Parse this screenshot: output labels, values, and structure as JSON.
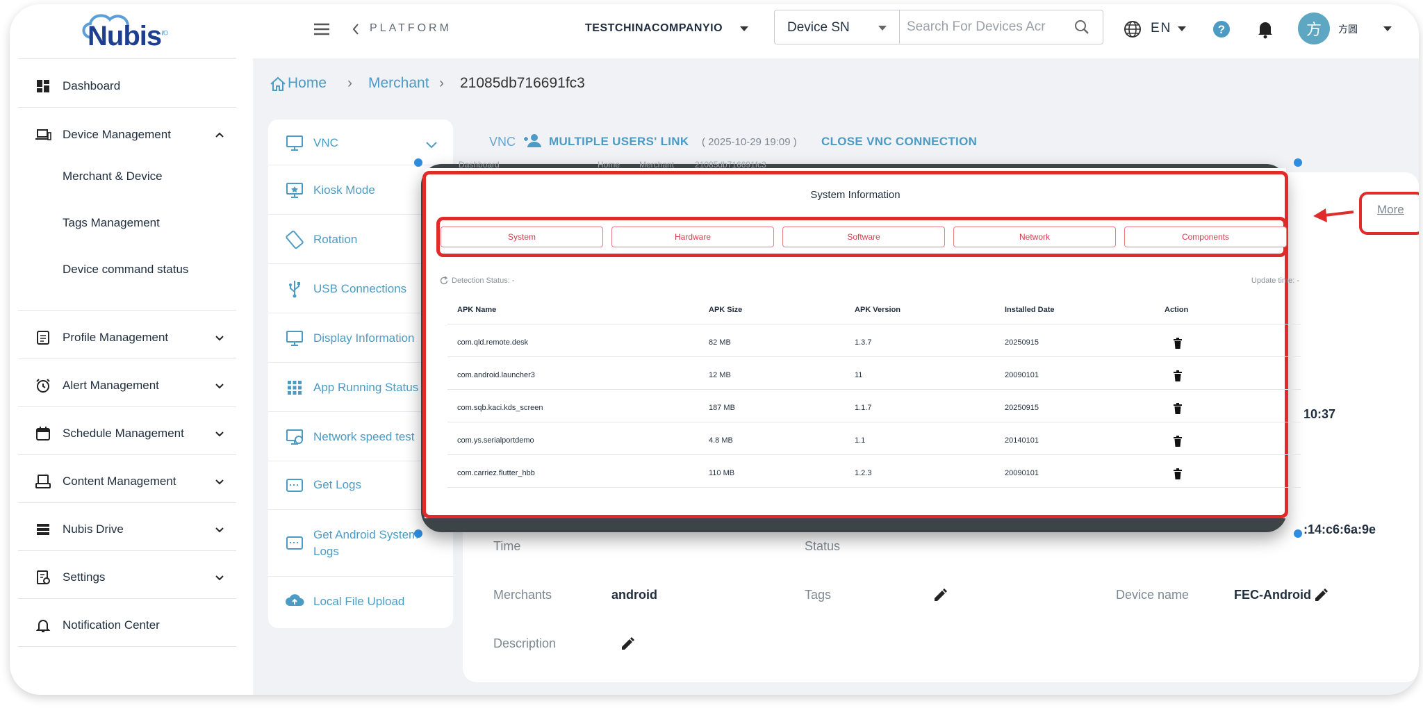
{
  "app": {
    "logo_text": "Nubis",
    "logo_superscript": "I/O"
  },
  "header": {
    "platform": "PLATFORM",
    "company": "TESTCHINACOMPANYIO",
    "search_type": "Device SN",
    "search_placeholder": "Search For Devices Acr",
    "language": "EN",
    "avatar_initial": "方",
    "username": "方圆"
  },
  "sidebar": {
    "items": [
      {
        "label": "Dashboard",
        "icon": "dashboard-icon"
      },
      {
        "label": "Device Management",
        "icon": "devices-icon",
        "expanded": true,
        "children": [
          "Merchant & Device",
          "Tags Management",
          "Device command status"
        ]
      },
      {
        "label": "Profile Management",
        "icon": "profile-icon"
      },
      {
        "label": "Alert Management",
        "icon": "alarm-icon"
      },
      {
        "label": "Schedule Management",
        "icon": "calendar-icon"
      },
      {
        "label": "Content Management",
        "icon": "content-icon"
      },
      {
        "label": "Nubis Drive",
        "icon": "drive-icon"
      },
      {
        "label": "Settings",
        "icon": "settings-icon"
      },
      {
        "label": "Notification Center",
        "icon": "bell-icon"
      }
    ]
  },
  "breadcrumb": {
    "home": "Home",
    "merchant": "Merchant",
    "device": "21085db716691fc3"
  },
  "device_menu": {
    "items": [
      {
        "label": "VNC",
        "icon": "vnc-icon"
      },
      {
        "label": "Kiosk Mode",
        "icon": "kiosk-icon"
      },
      {
        "label": "Rotation",
        "icon": "rotation-icon"
      },
      {
        "label": "USB Connections",
        "icon": "usb-icon"
      },
      {
        "label": "Display Information",
        "icon": "monitor-icon"
      },
      {
        "label": "App Running Status",
        "icon": "apps-grid-icon"
      },
      {
        "label": "Network speed test",
        "icon": "speed-test-icon"
      },
      {
        "label": "Get Logs",
        "icon": "logs-icon"
      },
      {
        "label": "Get Android System Logs",
        "icon": "android-logs-icon"
      },
      {
        "label": "Local File Upload",
        "icon": "cloud-upload-icon"
      }
    ]
  },
  "vnc_bar": {
    "label": "VNC",
    "multi_link": "MULTIPLE USERS' LINK",
    "timestamp": "( 2025-10-29 19:09 )",
    "close": "CLOSE VNC CONNECTION"
  },
  "vnc_ghost": {
    "dashboard": "Dashboard",
    "home": "Home",
    "merchant": "Merchant",
    "device": "21085db716691fc3"
  },
  "system_info": {
    "title": "System Information",
    "tabs": [
      "System",
      "Hardware",
      "Software",
      "Network",
      "Components"
    ],
    "detection_status": "Detection Status: -",
    "update_time": "Update time: -",
    "columns": [
      "APK Name",
      "APK Size",
      "APK Version",
      "Installed Date",
      "Action"
    ],
    "rows": [
      [
        "com.qld.remote.desk",
        "82 MB",
        "1.3.7",
        "20250915"
      ],
      [
        "com.android.launcher3",
        "12 MB",
        "11",
        "20090101"
      ],
      [
        "com.sqb.kaci.kds_screen",
        "187 MB",
        "1.1.7",
        "20250915"
      ],
      [
        "com.ys.serialportdemo",
        "4.8 MB",
        "1.1",
        "20140101"
      ],
      [
        "com.carriez.flutter_hbb",
        "110 MB",
        "1.2.3",
        "20090101"
      ]
    ]
  },
  "details": {
    "more": "More",
    "time_partial": "10:37",
    "label_time_1": "Time",
    "label_status": "Status",
    "mac_partial": ":14:c6:6a:9e",
    "merchants_label": "Merchants",
    "merchants_value": "android",
    "tags_label": "Tags",
    "device_name_label": "Device name",
    "device_name_value": "FEC-Android",
    "description_label": "Description"
  },
  "colors": {
    "accent": "#4c9bc4",
    "brand": "#1e3f8f",
    "highlight": "#e02b2b",
    "tab_text": "#d23c4e"
  }
}
